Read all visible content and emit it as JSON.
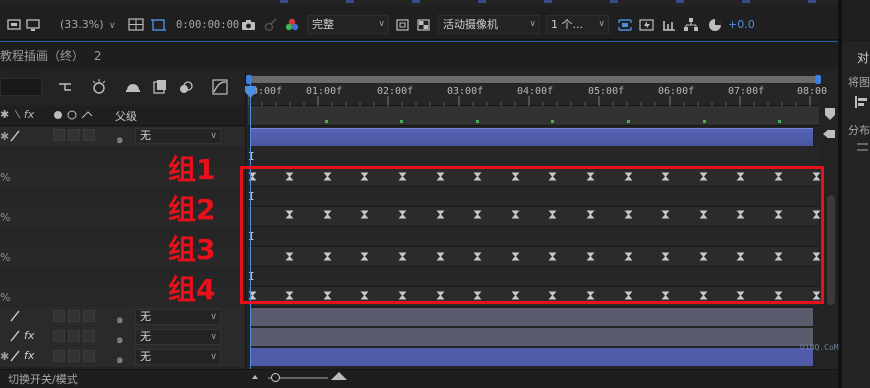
{
  "toolbar": {
    "zoom": "(33.3%)",
    "timecode": "0:00:00:00",
    "resolution": "完整",
    "camera": "活动摄像机",
    "views": "1 个...",
    "exposure": "+0.0"
  },
  "comp_tab": {
    "title": "教程插画（终）",
    "number": "2"
  },
  "right_panel": {
    "align_label": "对",
    "align_to": "将图",
    "distribute": "分布"
  },
  "column_headers": {
    "switches": "✱ ⟍ fx",
    "parent": "父级"
  },
  "ruler": {
    "ticks": [
      "0:00f",
      "01:00f",
      "02:00f",
      "03:00f",
      "04:00f",
      "05:00f",
      "06:00f",
      "07:00f",
      "08:00"
    ]
  },
  "layers": [
    {
      "parent": "无"
    },
    {
      "percent": "%"
    },
    {
      "percent": "%"
    },
    {
      "percent": "%"
    },
    {
      "percent": "%"
    },
    {
      "parent": "无"
    },
    {
      "parent": "无"
    },
    {
      "parent": "无"
    }
  ],
  "groups": [
    "组1",
    "组2",
    "组3",
    "组4"
  ],
  "footer": {
    "toggle_label": "切换开关/模式"
  },
  "watermark": "UiBQ.CoM",
  "colors": {
    "annotation_red": "#e8101a",
    "playhead_blue": "#4a8fe0",
    "layer_bar": "#4f5aa8",
    "shape_bar": "#5b5b6e"
  }
}
